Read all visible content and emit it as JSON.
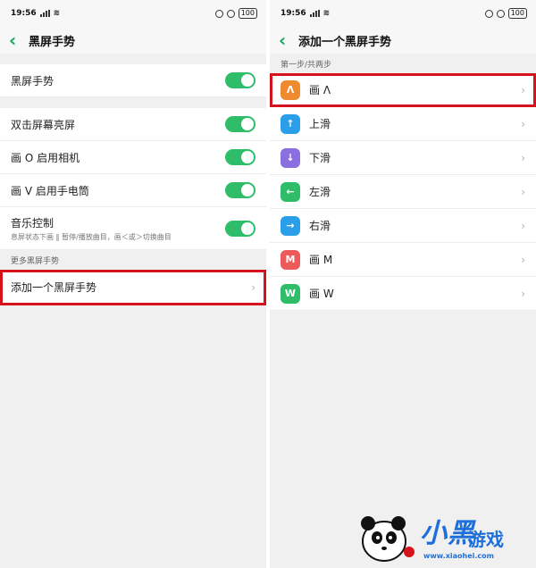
{
  "left": {
    "status": {
      "time": "19:56",
      "battery": "100"
    },
    "nav": {
      "title": "黑屏手势"
    },
    "master": {
      "label": "黑屏手势",
      "enabled": true
    },
    "options": [
      {
        "label": "双击屏幕亮屏",
        "enabled": true
      },
      {
        "label": "画 O 启用相机",
        "enabled": true
      },
      {
        "label": "画 V 启用手电筒",
        "enabled": true
      },
      {
        "label": "音乐控制",
        "sublabel": "息屏状态下画 ‖ 暂停/播放曲目，画＜或＞切换曲目",
        "enabled": true
      }
    ],
    "more_section_label": "更多黑屏手势",
    "add_gesture_label": "添加一个黑屏手势"
  },
  "right": {
    "status": {
      "time": "19:56",
      "battery": "100"
    },
    "nav": {
      "title": "添加一个黑屏手势"
    },
    "step_label": "第一步/共两步",
    "gestures": [
      {
        "icon_glyph": "Λ",
        "icon_name": "caret-up-gesture-icon",
        "color": "#f08a2e",
        "label": "画 Λ",
        "selected": true
      },
      {
        "icon_glyph": "↑",
        "icon_name": "arrow-up-icon",
        "color": "#2a9ee8",
        "label": "上滑",
        "selected": false
      },
      {
        "icon_glyph": "↓",
        "icon_name": "arrow-down-icon",
        "color": "#8b6ee0",
        "label": "下滑",
        "selected": false
      },
      {
        "icon_glyph": "←",
        "icon_name": "arrow-left-icon",
        "color": "#2fbd6a",
        "label": "左滑",
        "selected": false
      },
      {
        "icon_glyph": "→",
        "icon_name": "arrow-right-icon",
        "color": "#2a9ee8",
        "label": "右滑",
        "selected": false
      },
      {
        "icon_glyph": "M",
        "icon_name": "letter-m-icon",
        "color": "#ec5a5a",
        "label": "画 M",
        "selected": false
      },
      {
        "icon_glyph": "W",
        "icon_name": "letter-w-icon",
        "color": "#2fbd6a",
        "label": "画 W",
        "selected": false
      }
    ]
  },
  "colors": {
    "accent": "#2fbd6a",
    "highlight": "#d6121c"
  },
  "watermark": {
    "url": "www.xiaohei.com"
  }
}
